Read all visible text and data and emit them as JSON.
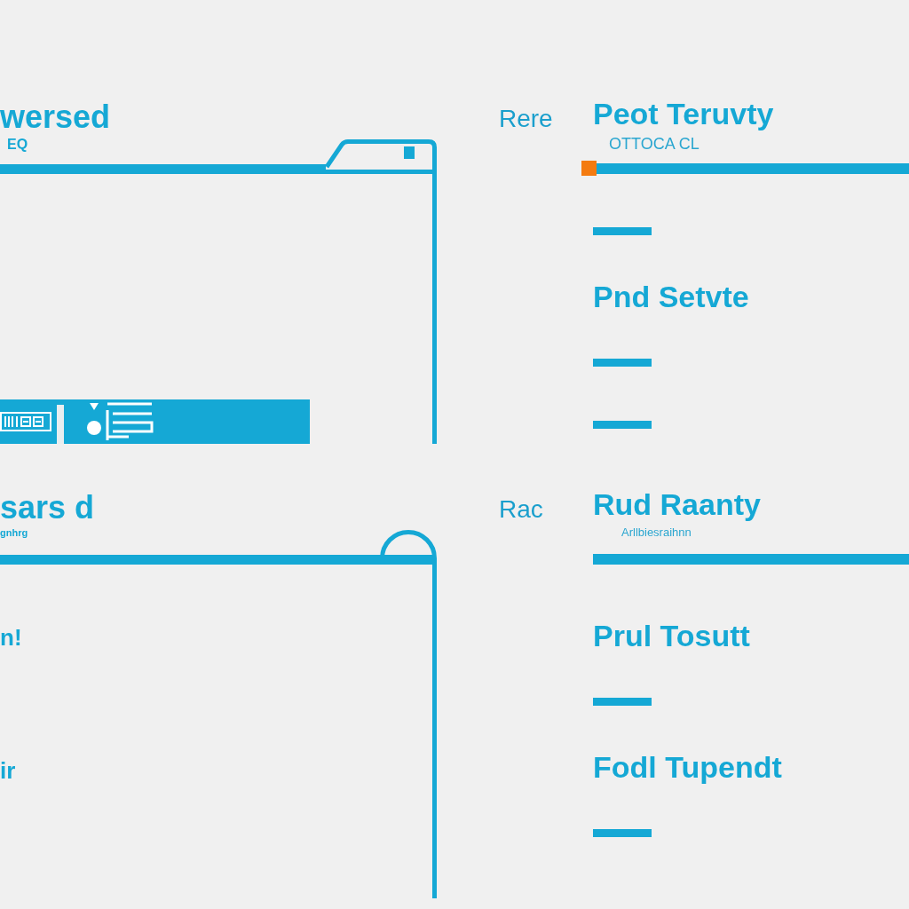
{
  "sections": [
    {
      "panel": {
        "kind": "toolbar",
        "title": "wersed",
        "subtitle": "EQ",
        "tab": {
          "kind": "slanted"
        }
      },
      "side_label": "Rere",
      "detail": {
        "title": "Peot Teruvty",
        "subtitle": "OTTOCA CL",
        "marker": true,
        "items": [
          {
            "kind": "bar"
          },
          {
            "kind": "heading",
            "text": "Pnd Setvte"
          },
          {
            "kind": "bar"
          },
          {
            "kind": "bar"
          }
        ]
      }
    },
    {
      "panel": {
        "kind": "list",
        "title": "sars d",
        "subtitle": "gnhrg",
        "tab": {
          "kind": "round"
        },
        "labels": [
          "n!",
          "ir"
        ]
      },
      "side_label": "Rac",
      "detail": {
        "title": "Rud Raanty",
        "subtitle": "Arllbiesraihnn",
        "items": [
          {
            "kind": "heading",
            "text": "Prul Tosutt"
          },
          {
            "kind": "bar"
          },
          {
            "kind": "heading",
            "text": "Fodl Tupendt"
          },
          {
            "kind": "bar"
          }
        ]
      }
    }
  ]
}
